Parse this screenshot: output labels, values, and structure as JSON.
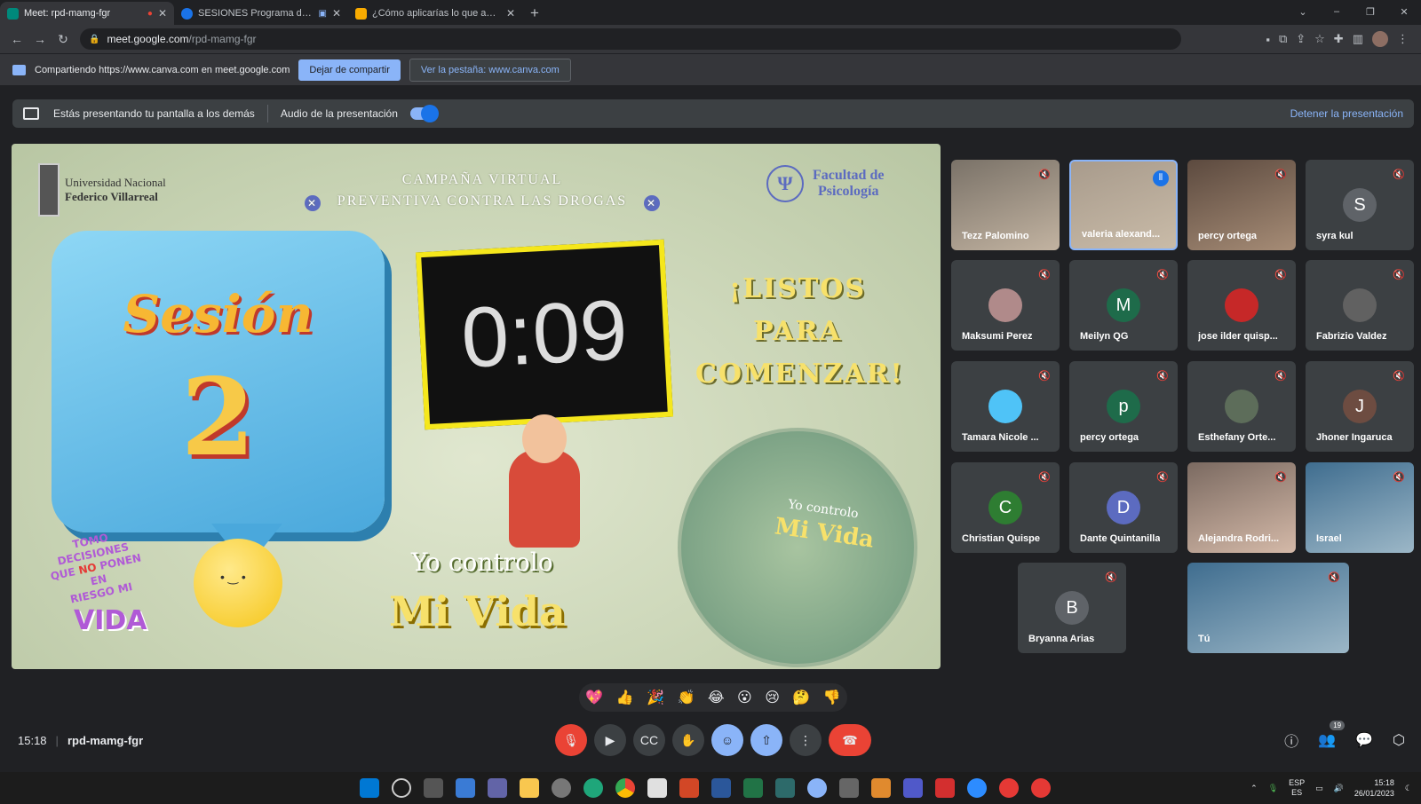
{
  "tabs": [
    {
      "label": "Meet: rpd-mamg-fgr",
      "favicon_color": "#00897b",
      "active": true
    },
    {
      "label": "SESIONES Programa de prev",
      "favicon_color": "#1a73e8",
      "active": false
    },
    {
      "label": "¿Cómo aplicarías lo que aprendis",
      "favicon_color": "#f9ab00",
      "active": false
    }
  ],
  "newtab": "+",
  "window_controls": [
    "⌄",
    "–",
    "❐",
    "✕"
  ],
  "address": {
    "host": "meet.google.com",
    "path": "/rpd-mamg-fgr"
  },
  "sharebar": {
    "text": "Compartiendo https://www.canva.com en meet.google.com",
    "stop_label": "Dejar de compartir",
    "view_label": "Ver la pestaña: www.canva.com"
  },
  "presbar": {
    "text": "Estás presentando tu pantalla a los demás",
    "audio_label": "Audio de la presentación",
    "audio_on": true,
    "stop_label": "Detener la presentación"
  },
  "slide": {
    "uni_line1": "Universidad Nacional",
    "uni_line2": "Federico Villarreal",
    "campaign_line1": "CAMPAÑA VIRTUAL",
    "campaign_line2": "PREVENTIVA CONTRA LAS DROGAS",
    "faculty_line1": "Facultad de",
    "faculty_line2": "Psicología",
    "session_word": "Sesión",
    "session_number": "2",
    "timer": "0:09",
    "listos_line1": "¡LISTOS",
    "listos_line2": "PARA",
    "listos_line3": "COMENZAR!",
    "yo_controlo": "Yo controlo",
    "mi_vida": "Mi Vida",
    "tomo_line1": "TOMO",
    "tomo_line2": "DECISIONES",
    "tomo_line3a": "QUE",
    "tomo_line3b": "NO",
    "tomo_line3c": "PONEN",
    "tomo_line4": "EN",
    "tomo_line5": "RIESGO MI",
    "vida": "VIDA",
    "circle_line1": "Yo controlo",
    "circle_line2": "Mi Vida"
  },
  "participants": [
    {
      "name": "Tezz Palomino",
      "type": "video",
      "style": "video"
    },
    {
      "name": "valeria alexand...",
      "type": "video",
      "style": "video2",
      "speaking": true
    },
    {
      "name": "percy ortega",
      "type": "video",
      "style": "video3"
    },
    {
      "name": "syra kul",
      "type": "avatar",
      "initial": "S",
      "color": "#5f6368"
    },
    {
      "name": "Maksumi Perez",
      "type": "avatar",
      "initial": "",
      "color": "#b08a8a"
    },
    {
      "name": "Meilyn QG",
      "type": "avatar",
      "initial": "M",
      "color": "#1e6b4a"
    },
    {
      "name": "jose ilder quisp...",
      "type": "avatar",
      "initial": "",
      "color": "#c62828"
    },
    {
      "name": "Fabrizio Valdez",
      "type": "avatar",
      "initial": "",
      "color": "#616161"
    },
    {
      "name": "Tamara Nicole ...",
      "type": "avatar",
      "initial": "",
      "color": "#4fc3f7"
    },
    {
      "name": "percy ortega",
      "type": "avatar",
      "initial": "p",
      "color": "#1e6b4a"
    },
    {
      "name": "Esthefany Orte...",
      "type": "avatar",
      "initial": "",
      "color": "#5d6d5a"
    },
    {
      "name": "Jhoner Ingaruca",
      "type": "avatar",
      "initial": "J",
      "color": "#6d4c41"
    },
    {
      "name": "Christian Quispe",
      "type": "avatar",
      "initial": "C",
      "color": "#2e7d32"
    },
    {
      "name": "Dante Quintanilla",
      "type": "avatar",
      "initial": "D",
      "color": "#5c6bc0"
    },
    {
      "name": "Alejandra Rodri...",
      "type": "video",
      "style": "video4"
    },
    {
      "name": "Israel",
      "type": "video",
      "style": "video5"
    },
    {
      "name": "Bryanna Arias",
      "type": "avatar",
      "initial": "B",
      "color": "#5f6368"
    },
    {
      "name": "Tú",
      "type": "video",
      "style": "video5"
    }
  ],
  "reactions": [
    "💖",
    "👍",
    "🎉",
    "👏",
    "😂",
    "😮",
    "😢",
    "🤔",
    "👎"
  ],
  "meeting": {
    "time": "15:18",
    "code": "rpd-mamg-fgr",
    "people_count": "19"
  },
  "taskbar": {
    "lang1": "ESP",
    "lang2": "ES",
    "time": "15:18",
    "date": "26/01/2023"
  }
}
